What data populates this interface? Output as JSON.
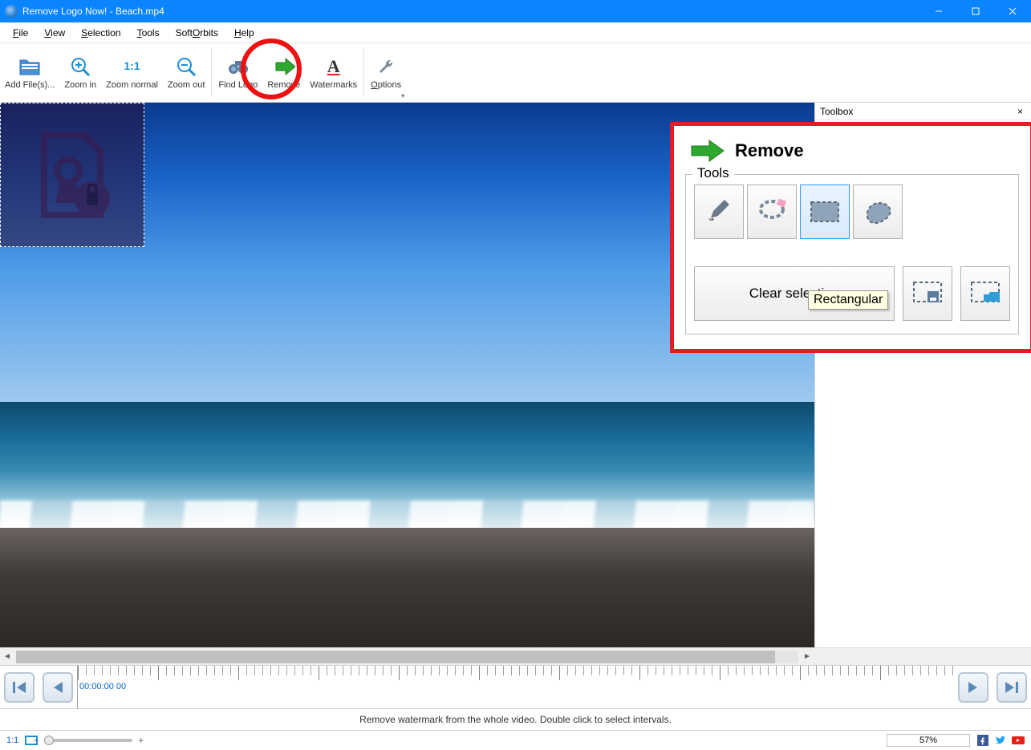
{
  "title": "Remove Logo Now! - Beach.mp4",
  "menu": {
    "file": "File",
    "view": "View",
    "selection": "Selection",
    "tools": "Tools",
    "softorbits": "SoftOrbits",
    "help": "Help"
  },
  "toolbar": {
    "add_files": "Add File(s)...",
    "zoom_in": "Zoom in",
    "zoom_normal": "Zoom normal",
    "zoom_out": "Zoom out",
    "find_logo": "Find Logo",
    "remove": "Remove",
    "watermarks": "Watermarks",
    "options": "Options"
  },
  "rpanel": {
    "title": "Toolbox"
  },
  "toolbox": {
    "title": "Remove",
    "tools_legend": "Tools",
    "tooltip": "Rectangular",
    "clear": "Clear selection"
  },
  "timeline": {
    "time": "00:00:00 00"
  },
  "hint": "Remove watermark from the whole video. Double click to select intervals.",
  "status": {
    "ratio": "1:1",
    "percent": "57%"
  }
}
